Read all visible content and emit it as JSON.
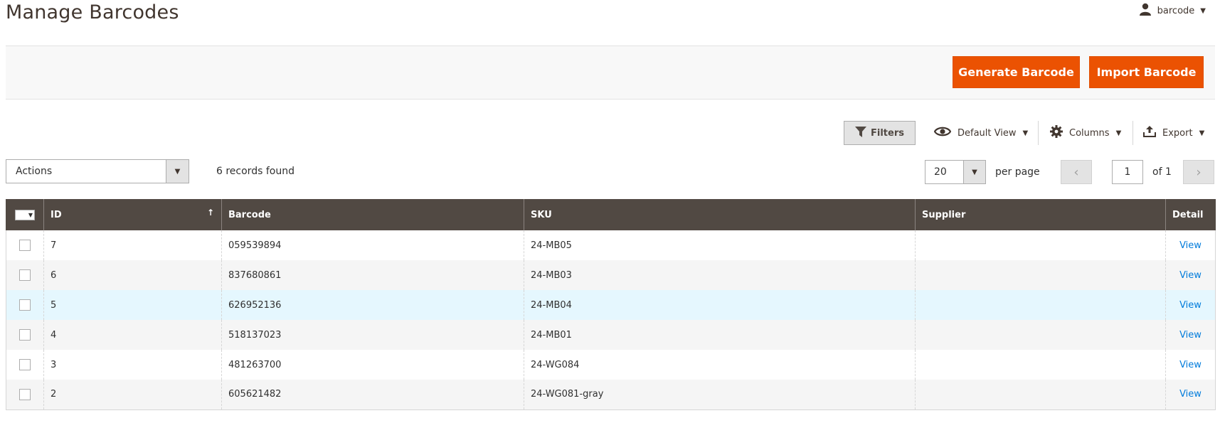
{
  "page": {
    "title": "Manage Barcodes"
  },
  "user": {
    "name": "barcode",
    "icon": "user-icon"
  },
  "actions": {
    "generate_label": "Generate Barcode",
    "import_label": "Import Barcode"
  },
  "toolbar": {
    "filters_label": "Filters",
    "view_label": "Default View",
    "columns_label": "Columns",
    "export_label": "Export"
  },
  "massaction": {
    "label": "Actions"
  },
  "records": {
    "text": "6 records found"
  },
  "pager": {
    "per_page": "20",
    "per_page_label": "per page",
    "current_page": "1",
    "of_label": "of 1"
  },
  "grid": {
    "columns": {
      "id": "ID",
      "barcode": "Barcode",
      "sku": "SKU",
      "supplier": "Supplier",
      "detail": "Detail"
    },
    "rows": [
      {
        "id": "7",
        "barcode": "059539894",
        "sku": "24-MB05",
        "supplier": "",
        "detail": "View"
      },
      {
        "id": "6",
        "barcode": "837680861",
        "sku": "24-MB03",
        "supplier": "",
        "detail": "View"
      },
      {
        "id": "5",
        "barcode": "626952136",
        "sku": "24-MB04",
        "supplier": "",
        "detail": "View"
      },
      {
        "id": "4",
        "barcode": "518137023",
        "sku": "24-MB01",
        "supplier": "",
        "detail": "View"
      },
      {
        "id": "3",
        "barcode": "481263700",
        "sku": "24-WG084",
        "supplier": "",
        "detail": "View"
      },
      {
        "id": "2",
        "barcode": "605621482",
        "sku": "24-WG081-gray",
        "supplier": "",
        "detail": "View"
      }
    ]
  },
  "colors": {
    "accent": "#eb5202",
    "header_bg": "#514943",
    "link": "#007bdb",
    "row_highlight": "#e5f7fe"
  }
}
